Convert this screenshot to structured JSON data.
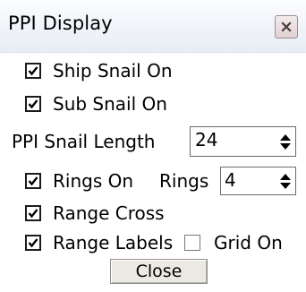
{
  "window": {
    "title": "PPI Display",
    "close_icon": "close-x-icon"
  },
  "options": {
    "ship_snail": {
      "label": "Ship Snail On",
      "checked": true
    },
    "sub_snail": {
      "label": "Sub Snail On",
      "checked": true
    },
    "snail_length": {
      "label": "PPI  Snail Length",
      "value": "24"
    },
    "rings_on": {
      "label": "Rings On",
      "checked": true
    },
    "rings": {
      "label": "Rings",
      "value": "4"
    },
    "range_cross": {
      "label": "Range Cross",
      "checked": true
    },
    "range_labels": {
      "label": "Range Labels",
      "checked": true
    },
    "grid_on": {
      "label": "Grid On",
      "checked": false
    }
  },
  "buttons": {
    "close_label": "Close"
  },
  "colors": {
    "title_bar": "#f2f5fa",
    "close_box": "#e2d0d2",
    "button_face": "#ece9e2"
  }
}
